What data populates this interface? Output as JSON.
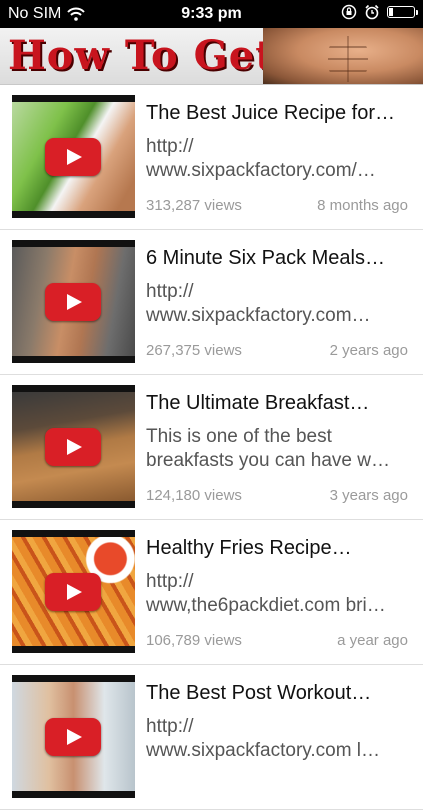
{
  "status_bar": {
    "carrier": "No SIM",
    "time": "9:33 pm",
    "battery_level": 0.15
  },
  "banner": {
    "title": "How To Get Abs"
  },
  "videos": [
    {
      "title": "The Best Juice Recipe for…",
      "desc_line1": "http://",
      "desc_line2": "www.sixpackfactory.com/…",
      "views": "313,287 views",
      "age": "8 months ago"
    },
    {
      "title": "6 Minute Six Pack Meals…",
      "desc_line1": "http://",
      "desc_line2": "www.sixpackfactory.com…",
      "views": "267,375 views",
      "age": "2 years ago"
    },
    {
      "title": "The Ultimate Breakfast…",
      "desc_line1": "This is one of the best",
      "desc_line2": "breakfasts you can have w…",
      "views": "124,180 views",
      "age": "3 years ago"
    },
    {
      "title": "Healthy Fries Recipe…",
      "desc_line1": "http://",
      "desc_line2": "www,the6packdiet.com bri…",
      "views": "106,789 views",
      "age": "a year ago"
    },
    {
      "title": "The Best Post Workout…",
      "desc_line1": "http://",
      "desc_line2": "www.sixpackfactory.com l…",
      "views": "",
      "age": ""
    }
  ],
  "colors": {
    "accent": "#c8141e",
    "play_button": "#d91f26",
    "meta_text": "#9a9a9a"
  }
}
